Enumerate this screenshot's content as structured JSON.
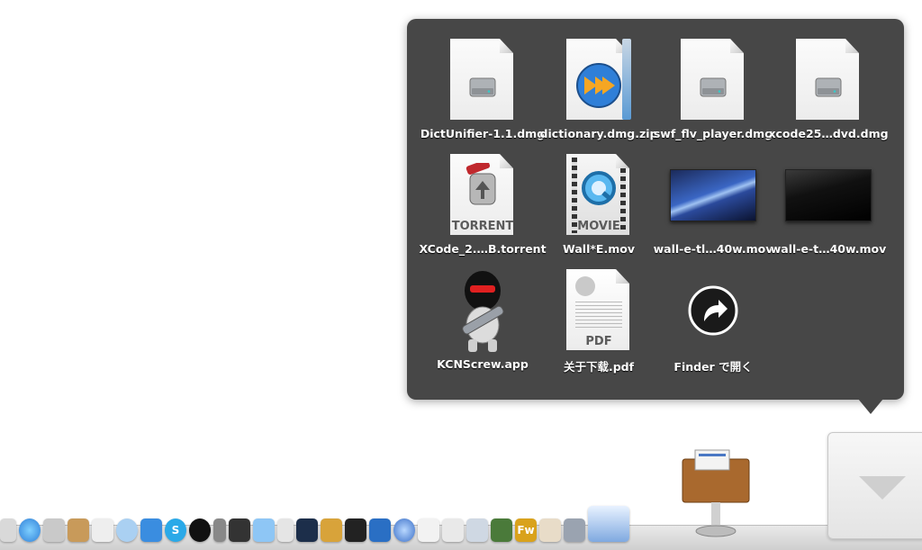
{
  "stack": {
    "items": [
      {
        "label": "DictUnifier-1.1.dmg",
        "kind": "dmg"
      },
      {
        "label": "dictionary.dmg.zip",
        "kind": "zip"
      },
      {
        "label": "swf_flv_player.dmg",
        "kind": "dmg"
      },
      {
        "label": "xcode25…dvd.dmg",
        "kind": "dmg"
      },
      {
        "label": "XCode_2.…B.torrent",
        "kind": "torrent",
        "tag": "TORRENT"
      },
      {
        "label": "Wall*E.mov",
        "kind": "movie",
        "tag": "MOVIE"
      },
      {
        "label": "wall-e-tl…40w.mov",
        "kind": "video-thumb"
      },
      {
        "label": "wall-e-t…40w.mov",
        "kind": "video-thumb-dark"
      },
      {
        "label": "KCNScrew.app",
        "kind": "app"
      },
      {
        "label": "关于下载.pdf",
        "kind": "pdf",
        "tag": "PDF"
      },
      {
        "label": "Finder で開く",
        "kind": "open-in-finder"
      }
    ]
  },
  "dock": {
    "icons": [
      "preview-icon",
      "quicktime-icon",
      "script-icon",
      "rabbit-icon",
      "dog-icon",
      "ichat-icon",
      "messenger-icon",
      "skype-icon",
      "qq-icon",
      "phone-icon",
      "screen-sharing-icon",
      "itunes-icon",
      "ipod-icon",
      "dashboard-icon",
      "fruit-icon",
      "imovie-icon",
      "clapper-icon",
      "network-icon",
      "textedit-icon",
      "pages-icon",
      "mail-icon",
      "app-store-icon",
      "fireworks-icon",
      "news-icon",
      "xcode-icon",
      "numbers-icon",
      "keynote-icon",
      "downloads-stack-icon"
    ],
    "fireworks_label": "Fw",
    "colors": {
      "accent_blue": "#2f7fd8",
      "popup_bg": "#474747"
    }
  }
}
